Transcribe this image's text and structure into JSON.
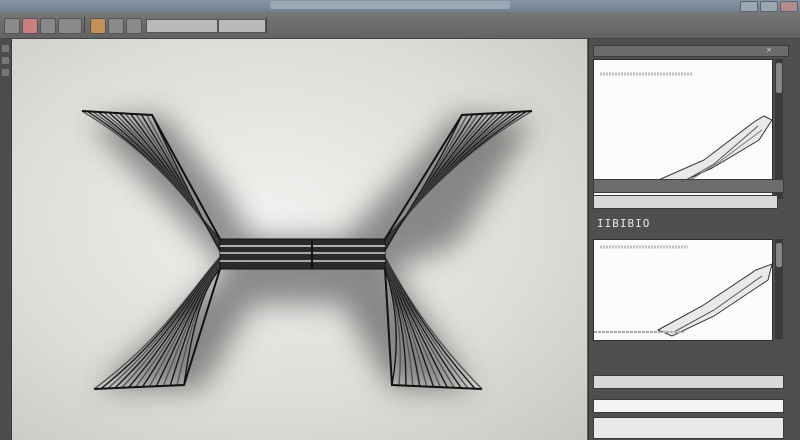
{
  "titlebar": {
    "title": ""
  },
  "toolbar": {
    "field_1": "",
    "field_2": ""
  },
  "viewport": {
    "model": "x-shaped-part",
    "colors": {
      "background": "#e8e6e3",
      "line": "#1a1a1a",
      "shadow": "#3a3a3a"
    }
  },
  "panel": {
    "preview_top_label": "",
    "property_row_1": "",
    "property_value": "IIBIBIO",
    "property_row_2": "",
    "preview_bottom_label": "",
    "bottom_row_1": "",
    "bottom_row_2": ""
  },
  "icons": [
    "close-icon",
    "minimize-icon",
    "maximize-icon"
  ]
}
